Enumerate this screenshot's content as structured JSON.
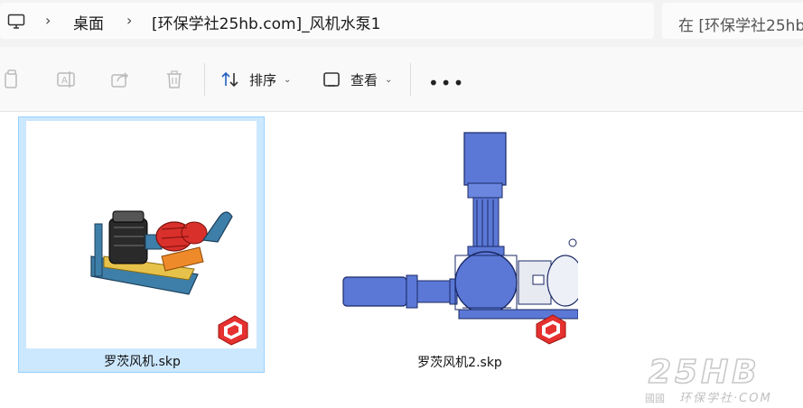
{
  "breadcrumb": {
    "root_icon": "monitor-icon",
    "items": [
      "桌面",
      "[环保学社25hb.com]_风机水泵1"
    ]
  },
  "search": {
    "placeholder": "在 [环保学社25hb"
  },
  "toolbar": {
    "icons": [
      "copy-icon",
      "rename-icon",
      "share-icon",
      "delete-icon"
    ],
    "sort_label": "排序",
    "view_label": "查看",
    "more_label": "•••"
  },
  "files": [
    {
      "name": "罗茨风机.skp",
      "selected": true,
      "badge": "sketchup-logo-icon"
    },
    {
      "name": "罗茨风机2.skp",
      "selected": false,
      "badge": "sketchup-logo-icon"
    }
  ],
  "watermark": {
    "big": "25HB",
    "small": "环保学社·COM",
    "prefix": "國國"
  }
}
